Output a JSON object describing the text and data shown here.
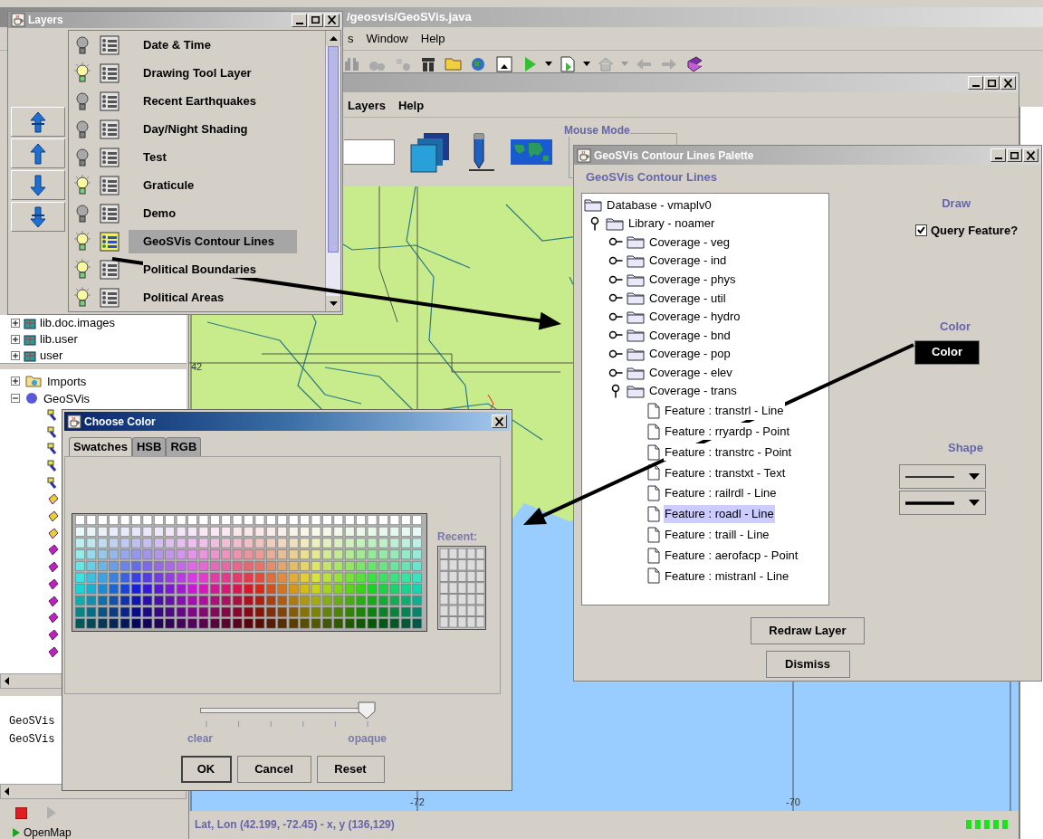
{
  "ide": {
    "title": "/geosvis/GeoSVis.java",
    "menu": [
      "s",
      "Window",
      "Help"
    ],
    "libraries": [
      {
        "label": "lib.doc.images",
        "expanded": false
      },
      {
        "label": "lib.user",
        "expanded": false
      },
      {
        "label": "user",
        "expanded": false
      }
    ],
    "project": [
      {
        "label": "Imports",
        "expanded": false
      },
      {
        "label": "GeoSVis",
        "expanded": true
      }
    ],
    "console": [
      "GeoSVis",
      "GeoSVis"
    ],
    "bottom_tab": "OpenMap"
  },
  "openmap": {
    "menu": [
      "Layers",
      "Help"
    ],
    "mouse_mode": "Mouse Mode",
    "map_labels": {
      "latitude": "42",
      "longitude_1": "-72",
      "longitude_2": "-70"
    },
    "status": "Lat, Lon (42.199, -72.45) - x, y (136,129)"
  },
  "layers": {
    "title": "Layers",
    "items": [
      {
        "name": "Date & Time",
        "visible": false,
        "selected": false
      },
      {
        "name": "Drawing Tool Layer",
        "visible": true,
        "selected": false
      },
      {
        "name": "Recent Earthquakes",
        "visible": false,
        "selected": false
      },
      {
        "name": "Day/Night Shading",
        "visible": false,
        "selected": false
      },
      {
        "name": "Test",
        "visible": false,
        "selected": false
      },
      {
        "name": "Graticule",
        "visible": true,
        "selected": false
      },
      {
        "name": "Demo",
        "visible": false,
        "selected": false
      },
      {
        "name": "GeoSVis Contour Lines",
        "visible": true,
        "selected": true
      },
      {
        "name": "Political Boundaries",
        "visible": true,
        "selected": false
      },
      {
        "name": "Political Areas",
        "visible": true,
        "selected": false
      }
    ]
  },
  "palette": {
    "title": "GeoSVis Contour Lines Palette",
    "heading": "GeoSVis Contour Lines",
    "tree": [
      {
        "label": "Database - vmaplv0",
        "kind": "folder",
        "selected": false,
        "children": [
          {
            "label": "Library - noamer",
            "kind": "folder",
            "expanded": true,
            "selected": false,
            "children": [
              {
                "label": "Coverage - veg",
                "kind": "folder",
                "expanded": false,
                "selected": false
              },
              {
                "label": "Coverage - ind",
                "kind": "folder",
                "expanded": false,
                "selected": false
              },
              {
                "label": "Coverage - phys",
                "kind": "folder",
                "expanded": false,
                "selected": false
              },
              {
                "label": "Coverage - util",
                "kind": "folder",
                "expanded": false,
                "selected": false
              },
              {
                "label": "Coverage - hydro",
                "kind": "folder",
                "expanded": false,
                "selected": false
              },
              {
                "label": "Coverage - bnd",
                "kind": "folder",
                "expanded": false,
                "selected": false
              },
              {
                "label": "Coverage - pop",
                "kind": "folder",
                "expanded": false,
                "selected": false
              },
              {
                "label": "Coverage - elev",
                "kind": "folder",
                "expanded": false,
                "selected": false
              },
              {
                "label": "Coverage - trans",
                "kind": "folder",
                "expanded": true,
                "selected": false,
                "children": [
                  {
                    "label": "Feature : transtrl - Line",
                    "kind": "file",
                    "selected": false
                  },
                  {
                    "label": "Feature : rryardp - Point",
                    "kind": "file",
                    "selected": false
                  },
                  {
                    "label": "Feature : transtrc - Point",
                    "kind": "file",
                    "selected": false
                  },
                  {
                    "label": "Feature : transtxt - Text",
                    "kind": "file",
                    "selected": false
                  },
                  {
                    "label": "Feature : railrdl - Line",
                    "kind": "file",
                    "selected": false
                  },
                  {
                    "label": "Feature : roadl - Line",
                    "kind": "file",
                    "selected": true
                  },
                  {
                    "label": "Feature : traill - Line",
                    "kind": "file",
                    "selected": false
                  },
                  {
                    "label": "Feature : aerofacp - Point",
                    "kind": "file",
                    "selected": false
                  },
                  {
                    "label": "Feature : mistranl - Line",
                    "kind": "file",
                    "selected": false
                  }
                ]
              }
            ]
          }
        ]
      }
    ],
    "draw_label": "Draw",
    "query": {
      "label": "Query Feature?",
      "checked": true
    },
    "color_label": "Color",
    "color_button": "Color",
    "shape_label": "Shape",
    "shapes": [
      {
        "kind": "thin"
      },
      {
        "kind": "thick"
      }
    ],
    "buttons": [
      "Redraw Layer",
      "Dismiss"
    ]
  },
  "color_chooser": {
    "title": "Choose Color",
    "tabs": [
      {
        "label": "Swatches",
        "selected": true
      },
      {
        "label": "HSB",
        "selected": false
      },
      {
        "label": "RGB",
        "selected": false
      }
    ],
    "recent_label": "Recent:",
    "opacity": {
      "level": 1,
      "min_label": "clear",
      "max_label": "opaque"
    },
    "buttons": [
      "OK",
      "Cancel",
      "Reset"
    ]
  }
}
